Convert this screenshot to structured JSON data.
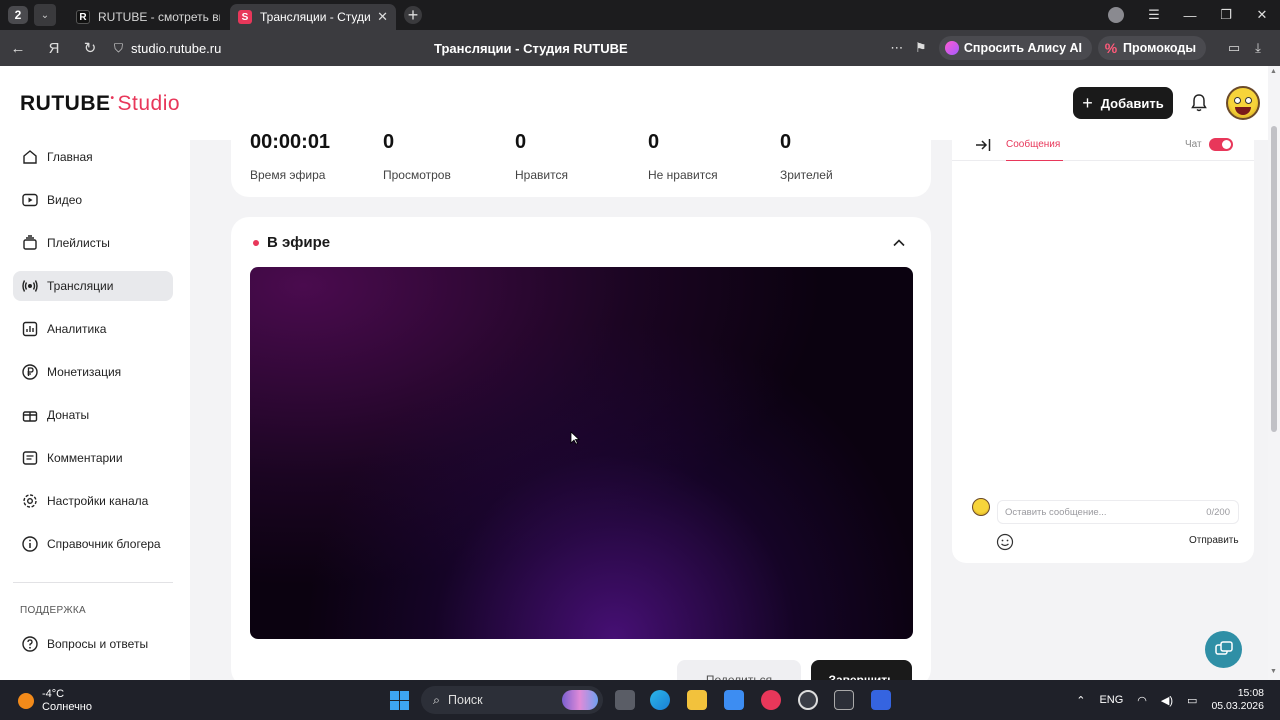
{
  "browser": {
    "tab_count": "2",
    "tabs": [
      {
        "title": "RUTUBE - смотреть виде",
        "favicon": "R"
      },
      {
        "title": "Трансляции - Студия R",
        "favicon": "S"
      }
    ],
    "url": "studio.rutube.ru",
    "page_title": "Трансляции - Студия RUTUBE",
    "alisa_label": "Спросить Алису AI",
    "promo_label": "Промокоды"
  },
  "header": {
    "logo_main": "RUTUBE",
    "logo_studio": "Studio",
    "add_label": "Добавить"
  },
  "sidebar": {
    "items": [
      {
        "label": "Главная",
        "icon": "home-icon"
      },
      {
        "label": "Видео",
        "icon": "video-icon"
      },
      {
        "label": "Плейлисты",
        "icon": "playlist-icon"
      },
      {
        "label": "Трансляции",
        "icon": "broadcast-icon"
      },
      {
        "label": "Аналитика",
        "icon": "analytics-icon"
      },
      {
        "label": "Монетизация",
        "icon": "ruble-icon"
      },
      {
        "label": "Донаты",
        "icon": "gift-icon"
      },
      {
        "label": "Комментарии",
        "icon": "comment-icon"
      },
      {
        "label": "Настройки канала",
        "icon": "gear-icon"
      },
      {
        "label": "Справочник блогера",
        "icon": "info-icon"
      }
    ],
    "section_label": "ПОДДЕРЖКА",
    "support_items": [
      {
        "label": "Вопросы и ответы",
        "icon": "help-icon"
      }
    ]
  },
  "stats": [
    {
      "value": "00:00:01",
      "label": "Время эфира"
    },
    {
      "value": "0",
      "label": "Просмотров"
    },
    {
      "value": "0",
      "label": "Нравится"
    },
    {
      "value": "0",
      "label": "Не нравится"
    },
    {
      "value": "0",
      "label": "Зрителей"
    }
  ],
  "live": {
    "title": "В эфире",
    "share_label": "Поделиться",
    "end_label": "Завершить"
  },
  "chat": {
    "tab_label": "Сообщения",
    "toggle_label": "Чат",
    "input_placeholder": "Оставить сообщение...",
    "counter": "0/200",
    "send_label": "Отправить"
  },
  "taskbar": {
    "temperature": "-4°C",
    "weather": "Солнечно",
    "search_label": "Поиск",
    "lang": "ENG",
    "time": "15:08",
    "date": "05.03.2026"
  },
  "colors": {
    "accent": "#e8375a",
    "dark_button": "#1a1a1a"
  }
}
